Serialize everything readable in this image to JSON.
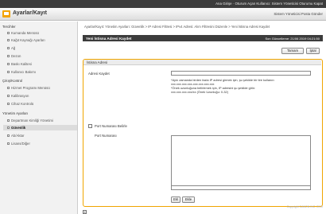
{
  "topbar": {
    "links": "Ana Girişe · Oturum Açan Kullanıcı: Sistem Yöneticisi Oturumu Kapat"
  },
  "header": {
    "title": "Ayarlar/Kayıt",
    "mode": "Sistem Yöneticisi Posta Gönder"
  },
  "sidebar": {
    "section1": "Tercihler",
    "items1": [
      "Kumanda Menüsü",
      "Kağıt Kaynağı Ayarları",
      "Ağ",
      "Dezon",
      "Baskı Kalitesi",
      "Kullanıcı Bakımı"
    ],
    "section2": "Çıkış/Kontrol",
    "items2": [
      "Hizmet Programı Menüsü",
      "Kalibrasyon",
      "Cihaz Kontrolü"
    ],
    "section3": "Yönetim Ayarları",
    "items3": [
      "Departman Kimliği Yönetimi",
      "Güvenlik",
      "Ab/Aktar",
      "Lisans/Diğer"
    ]
  },
  "main": {
    "breadcrumb": "Ayarlar/Kayıt: Yönetim Ayarları: Güvenlik > IP Adresi Filtresi > IPv4 Adresi: Alım Filtresini Düzenle > Yeni İstisna Adresi Kaydet",
    "title": "Yeni İstisna Adresi Kaydet",
    "updated": "Son Güncelleme: 21/06 2019 04:21:50",
    "ok_top": "Tamam",
    "cancel_top": "İptal",
    "panel_title": "İstisna Adresi",
    "address_label": "Adresi Kaydet",
    "address_value": "",
    "note_line1": "*Aynı zamanda birden fazla IP adresi girmek için, şu şekilde bir tire kullanın:",
    "note_line2": "xxx.xxx.xxx.xxx-xxx.xxx.xxx.xxx",
    "note_line3": "*Önek uzunluğuna belirlemek için, IP adresini şu şekilde girin:",
    "note_line4": "xxx.xxx.xxx.xxx/xx (Önek Uzunluğu: 0-32)",
    "port_check_label": "Port Numarası Belirle",
    "port_number_label": "Port Numarası",
    "port_input_value": "",
    "add_button": "Ekl",
    "delete_button": "Ekle",
    "bottom_x": "X"
  },
  "footer": {
    "copyright": "Copyright CANON INC. 2019"
  }
}
